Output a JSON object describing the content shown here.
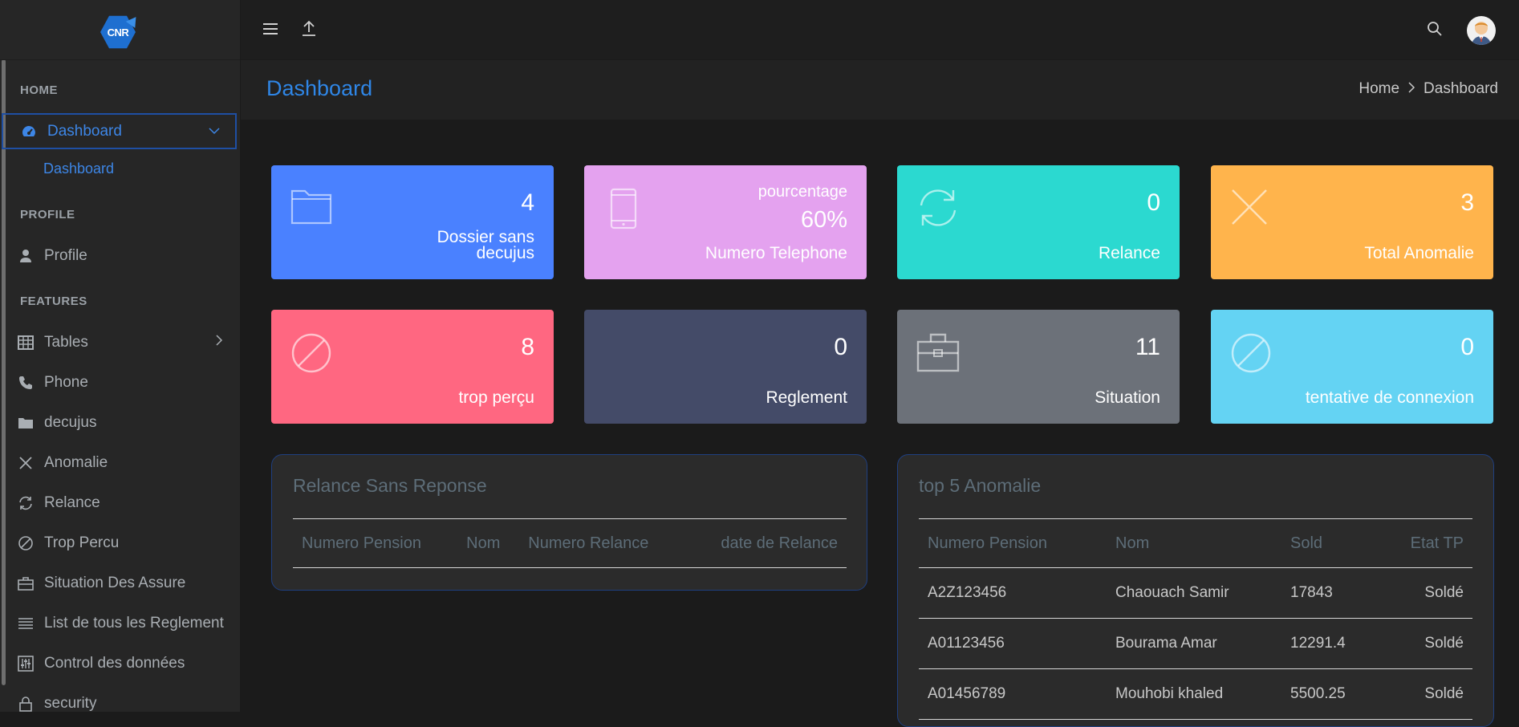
{
  "brand": {
    "logo_text": "CNR"
  },
  "sidebar": {
    "sections": {
      "home": "HOME",
      "profile": "PROFILE",
      "features": "FEATURES"
    },
    "dashboard": {
      "label": "Dashboard",
      "sub_label": "Dashboard"
    },
    "profile_item": "Profile",
    "items": [
      {
        "label": "Tables",
        "icon": "table-icon"
      },
      {
        "label": "Phone",
        "icon": "phone-icon"
      },
      {
        "label": "decujus",
        "icon": "folder-icon"
      },
      {
        "label": "Anomalie",
        "icon": "close-icon"
      },
      {
        "label": "Relance",
        "icon": "refresh-icon"
      },
      {
        "label": "Trop Percu",
        "icon": "ban-icon"
      },
      {
        "label": "Situation Des Assure",
        "icon": "briefcase-icon"
      },
      {
        "label": "List de tous les Reglement",
        "icon": "list-icon"
      },
      {
        "label": "Control des données",
        "icon": "sliders-icon"
      },
      {
        "label": "security",
        "icon": "lock-icon"
      }
    ]
  },
  "header": {
    "title": "Dashboard",
    "breadcrumb": {
      "home": "Home",
      "current": "Dashboard"
    }
  },
  "cards": [
    {
      "value": "4",
      "label_line1": "Dossier sans",
      "label_line2": "decujus",
      "color": "#4a81ff",
      "icon": "folder-icon"
    },
    {
      "sub": "pourcentage",
      "value": "60%",
      "label": "Numero Telephone",
      "color": "#e4a2ef",
      "icon": "mobile-icon"
    },
    {
      "value": "0",
      "label": "Relance",
      "color": "#2bd9d0",
      "icon": "refresh-icon"
    },
    {
      "value": "3",
      "label": "Total Anomalie",
      "color": "#ffb44c",
      "icon": "close-icon"
    },
    {
      "value": "8",
      "label": "trop perçu",
      "color": "#ff6781",
      "icon": "ban-icon"
    },
    {
      "value": "0",
      "label": "Reglement",
      "color": "#444b68",
      "icon": ""
    },
    {
      "value": "11",
      "label": "Situation",
      "color": "#6c7179",
      "icon": "briefcase-icon"
    },
    {
      "value": "0",
      "label": "tentative de connexion",
      "color": "#64d3f3",
      "icon": "ban-icon"
    }
  ],
  "relance_panel": {
    "title": "Relance Sans Reponse",
    "columns": [
      "Numero Pension",
      "Nom",
      "Numero Relance",
      "date de Relance"
    ]
  },
  "anomalie_panel": {
    "title": "top 5 Anomalie",
    "columns": [
      "Numero Pension",
      "Nom",
      "Sold",
      "Etat TP"
    ],
    "rows": [
      [
        "A2Z123456",
        "Chaouach Samir",
        "17843",
        "Soldé"
      ],
      [
        "A01123456",
        "Bourama Amar",
        "12291.4",
        "Soldé"
      ],
      [
        "A01456789",
        "Mouhobi khaled",
        "5500.25",
        "Soldé"
      ]
    ]
  }
}
